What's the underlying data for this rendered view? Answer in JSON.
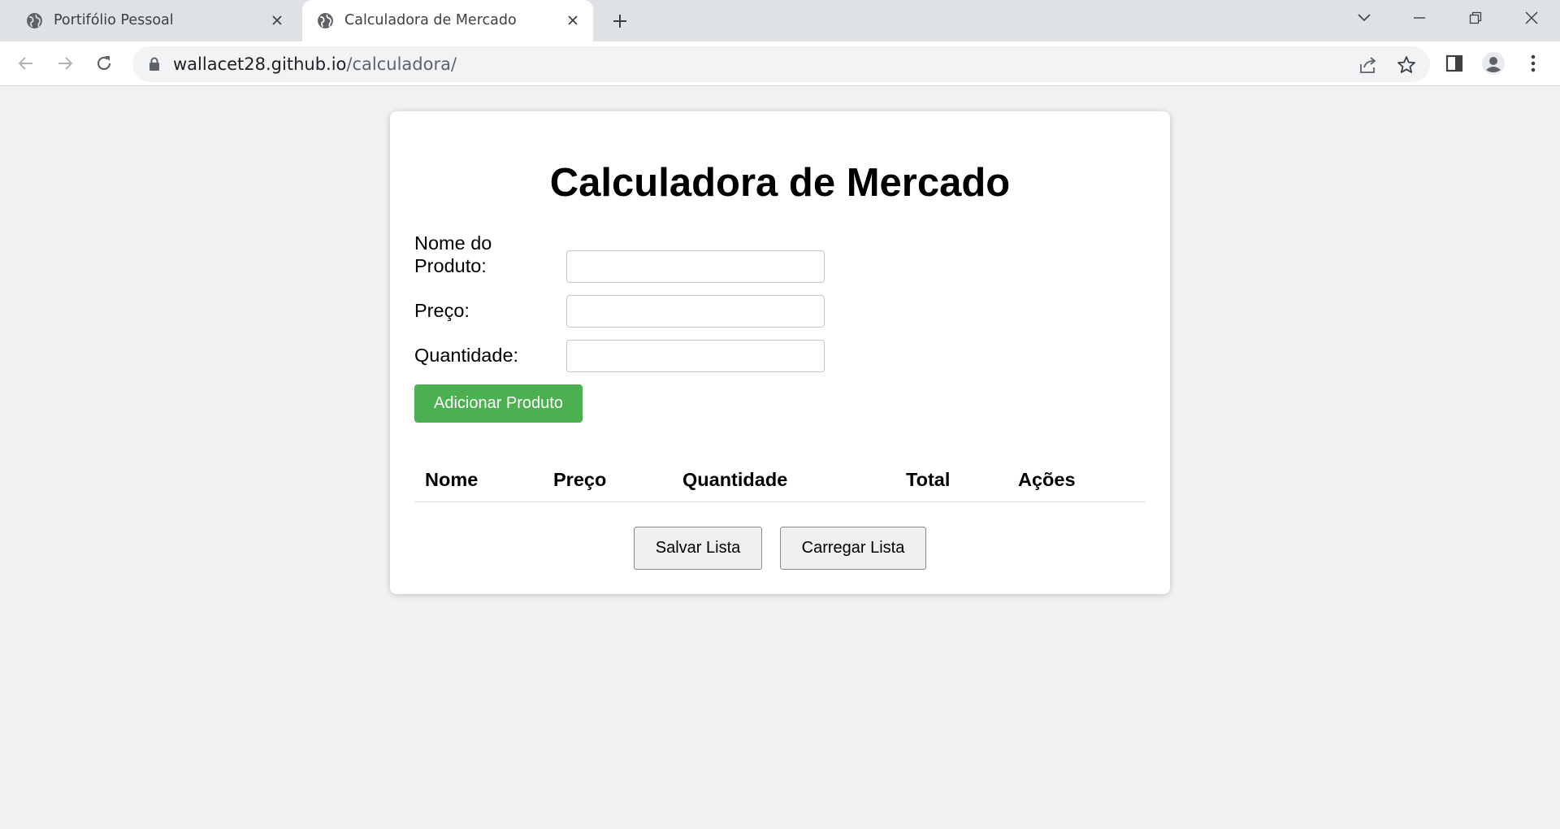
{
  "browser": {
    "tabs": [
      {
        "title": "Portifólio Pessoal",
        "active": false
      },
      {
        "title": "Calculadora de Mercado",
        "active": true
      }
    ],
    "url_host": "wallacet28.github.io",
    "url_path": "/calculadora/"
  },
  "page": {
    "title": "Calculadora de Mercado",
    "form": {
      "nome_label_line1": "Nome do",
      "nome_label_line2": "Produto:",
      "nome_value": "",
      "preco_label": "Preço:",
      "preco_value": "",
      "quantidade_label": "Quantidade:",
      "quantidade_value": "",
      "add_button": "Adicionar Produto"
    },
    "table": {
      "headers": [
        "Nome",
        "Preço",
        "Quantidade",
        "Total",
        "Ações"
      ],
      "rows": []
    },
    "actions": {
      "save": "Salvar Lista",
      "load": "Carregar Lista"
    }
  },
  "colors": {
    "accent": "#4caf50",
    "background": "#f2f2f2",
    "tabstrip": "#dee1e6"
  }
}
